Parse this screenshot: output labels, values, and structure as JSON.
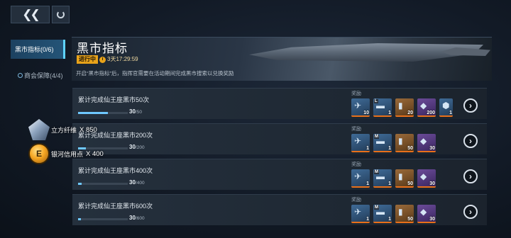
{
  "topbar": {
    "back_icon": "double-chevron-left-icon",
    "refresh_icon": "refresh-icon"
  },
  "sidebar": {
    "items": [
      {
        "label": "黑市指标(0/6)",
        "active": true
      },
      {
        "label": "商会保障(4/4)",
        "active": false
      }
    ]
  },
  "banner": {
    "title": "黑市指标",
    "status": "进行中",
    "timer": "3天17:29:59",
    "description": "开启“黑市指标”后，指挥官需要在活动期间完成黑市搜索以兑换奖励"
  },
  "rewards_label": "奖励",
  "tasks": [
    {
      "title": "累计完成仙王座黑市50次",
      "current": "30",
      "total": "/50",
      "progress": 0.6,
      "rewards": [
        {
          "icon": "ship-part-icon",
          "tag": "",
          "count": "10",
          "rarity": "blue"
        },
        {
          "icon": "blueprint-icon",
          "tag": "L",
          "count": "1",
          "rarity": "blue"
        },
        {
          "icon": "crate-icon",
          "tag": "",
          "count": "20",
          "rarity": "orange"
        },
        {
          "icon": "crystal-icon",
          "tag": "",
          "count": "200",
          "rarity": "purple"
        },
        {
          "icon": "module-icon",
          "tag": "",
          "count": "1",
          "rarity": "blue"
        }
      ]
    },
    {
      "title": "累计完成仙王座黑市200次",
      "current": "30",
      "total": "/200",
      "progress": 0.15,
      "rewards": [
        {
          "icon": "ship-part-icon",
          "tag": "",
          "count": "1",
          "rarity": "blue"
        },
        {
          "icon": "blueprint-icon",
          "tag": "M",
          "count": "1",
          "rarity": "blue"
        },
        {
          "icon": "crate-icon",
          "tag": "",
          "count": "50",
          "rarity": "orange"
        },
        {
          "icon": "crystal-icon",
          "tag": "",
          "count": "30",
          "rarity": "purple"
        }
      ]
    },
    {
      "title": "累计完成仙王座黑市400次",
      "current": "30",
      "total": "/400",
      "progress": 0.075,
      "rewards": [
        {
          "icon": "ship-part-icon",
          "tag": "",
          "count": "1",
          "rarity": "blue"
        },
        {
          "icon": "blueprint-icon",
          "tag": "M",
          "count": "1",
          "rarity": "blue"
        },
        {
          "icon": "crate-icon",
          "tag": "",
          "count": "50",
          "rarity": "orange"
        },
        {
          "icon": "crystal-icon",
          "tag": "",
          "count": "30",
          "rarity": "purple"
        }
      ]
    },
    {
      "title": "累计完成仙王座黑市600次",
      "current": "30",
      "total": "/600",
      "progress": 0.05,
      "rewards": [
        {
          "icon": "ship-part-icon",
          "tag": "",
          "count": "1",
          "rarity": "blue"
        },
        {
          "icon": "blueprint-icon",
          "tag": "M",
          "count": "1",
          "rarity": "blue"
        },
        {
          "icon": "crate-icon",
          "tag": "",
          "count": "50",
          "rarity": "orange"
        },
        {
          "icon": "crystal-icon",
          "tag": "",
          "count": "30",
          "rarity": "purple"
        }
      ]
    }
  ],
  "currency_overlay": [
    {
      "label": "立方纤维",
      "amount": "X 850",
      "icon": "cube-fiber-icon"
    },
    {
      "label": "银河信用点",
      "amount": "X 400",
      "icon": "galaxy-credit-icon"
    }
  ],
  "colors": {
    "accent": "#5fd3ff",
    "status": "#e8a31a",
    "progress": "#6fc8ff"
  }
}
